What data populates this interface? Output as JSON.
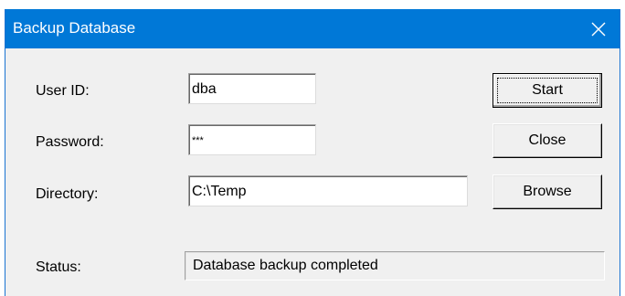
{
  "window": {
    "title": "Backup Database"
  },
  "icons": {
    "close": "close-icon"
  },
  "colors": {
    "titlebar": "#0078d7",
    "dialog_background": "#f0f0f0",
    "text": "#000000"
  },
  "form": {
    "user_id_label": "User ID:",
    "user_id_value": "dba",
    "password_label": "Password:",
    "password_value": "***",
    "directory_label": "Directory:",
    "directory_value": "C:\\Temp",
    "status_label": "Status:",
    "status_value": "Database backup completed"
  },
  "buttons": {
    "start_label": "Start",
    "close_label": "Close",
    "browse_label": "Browse"
  }
}
